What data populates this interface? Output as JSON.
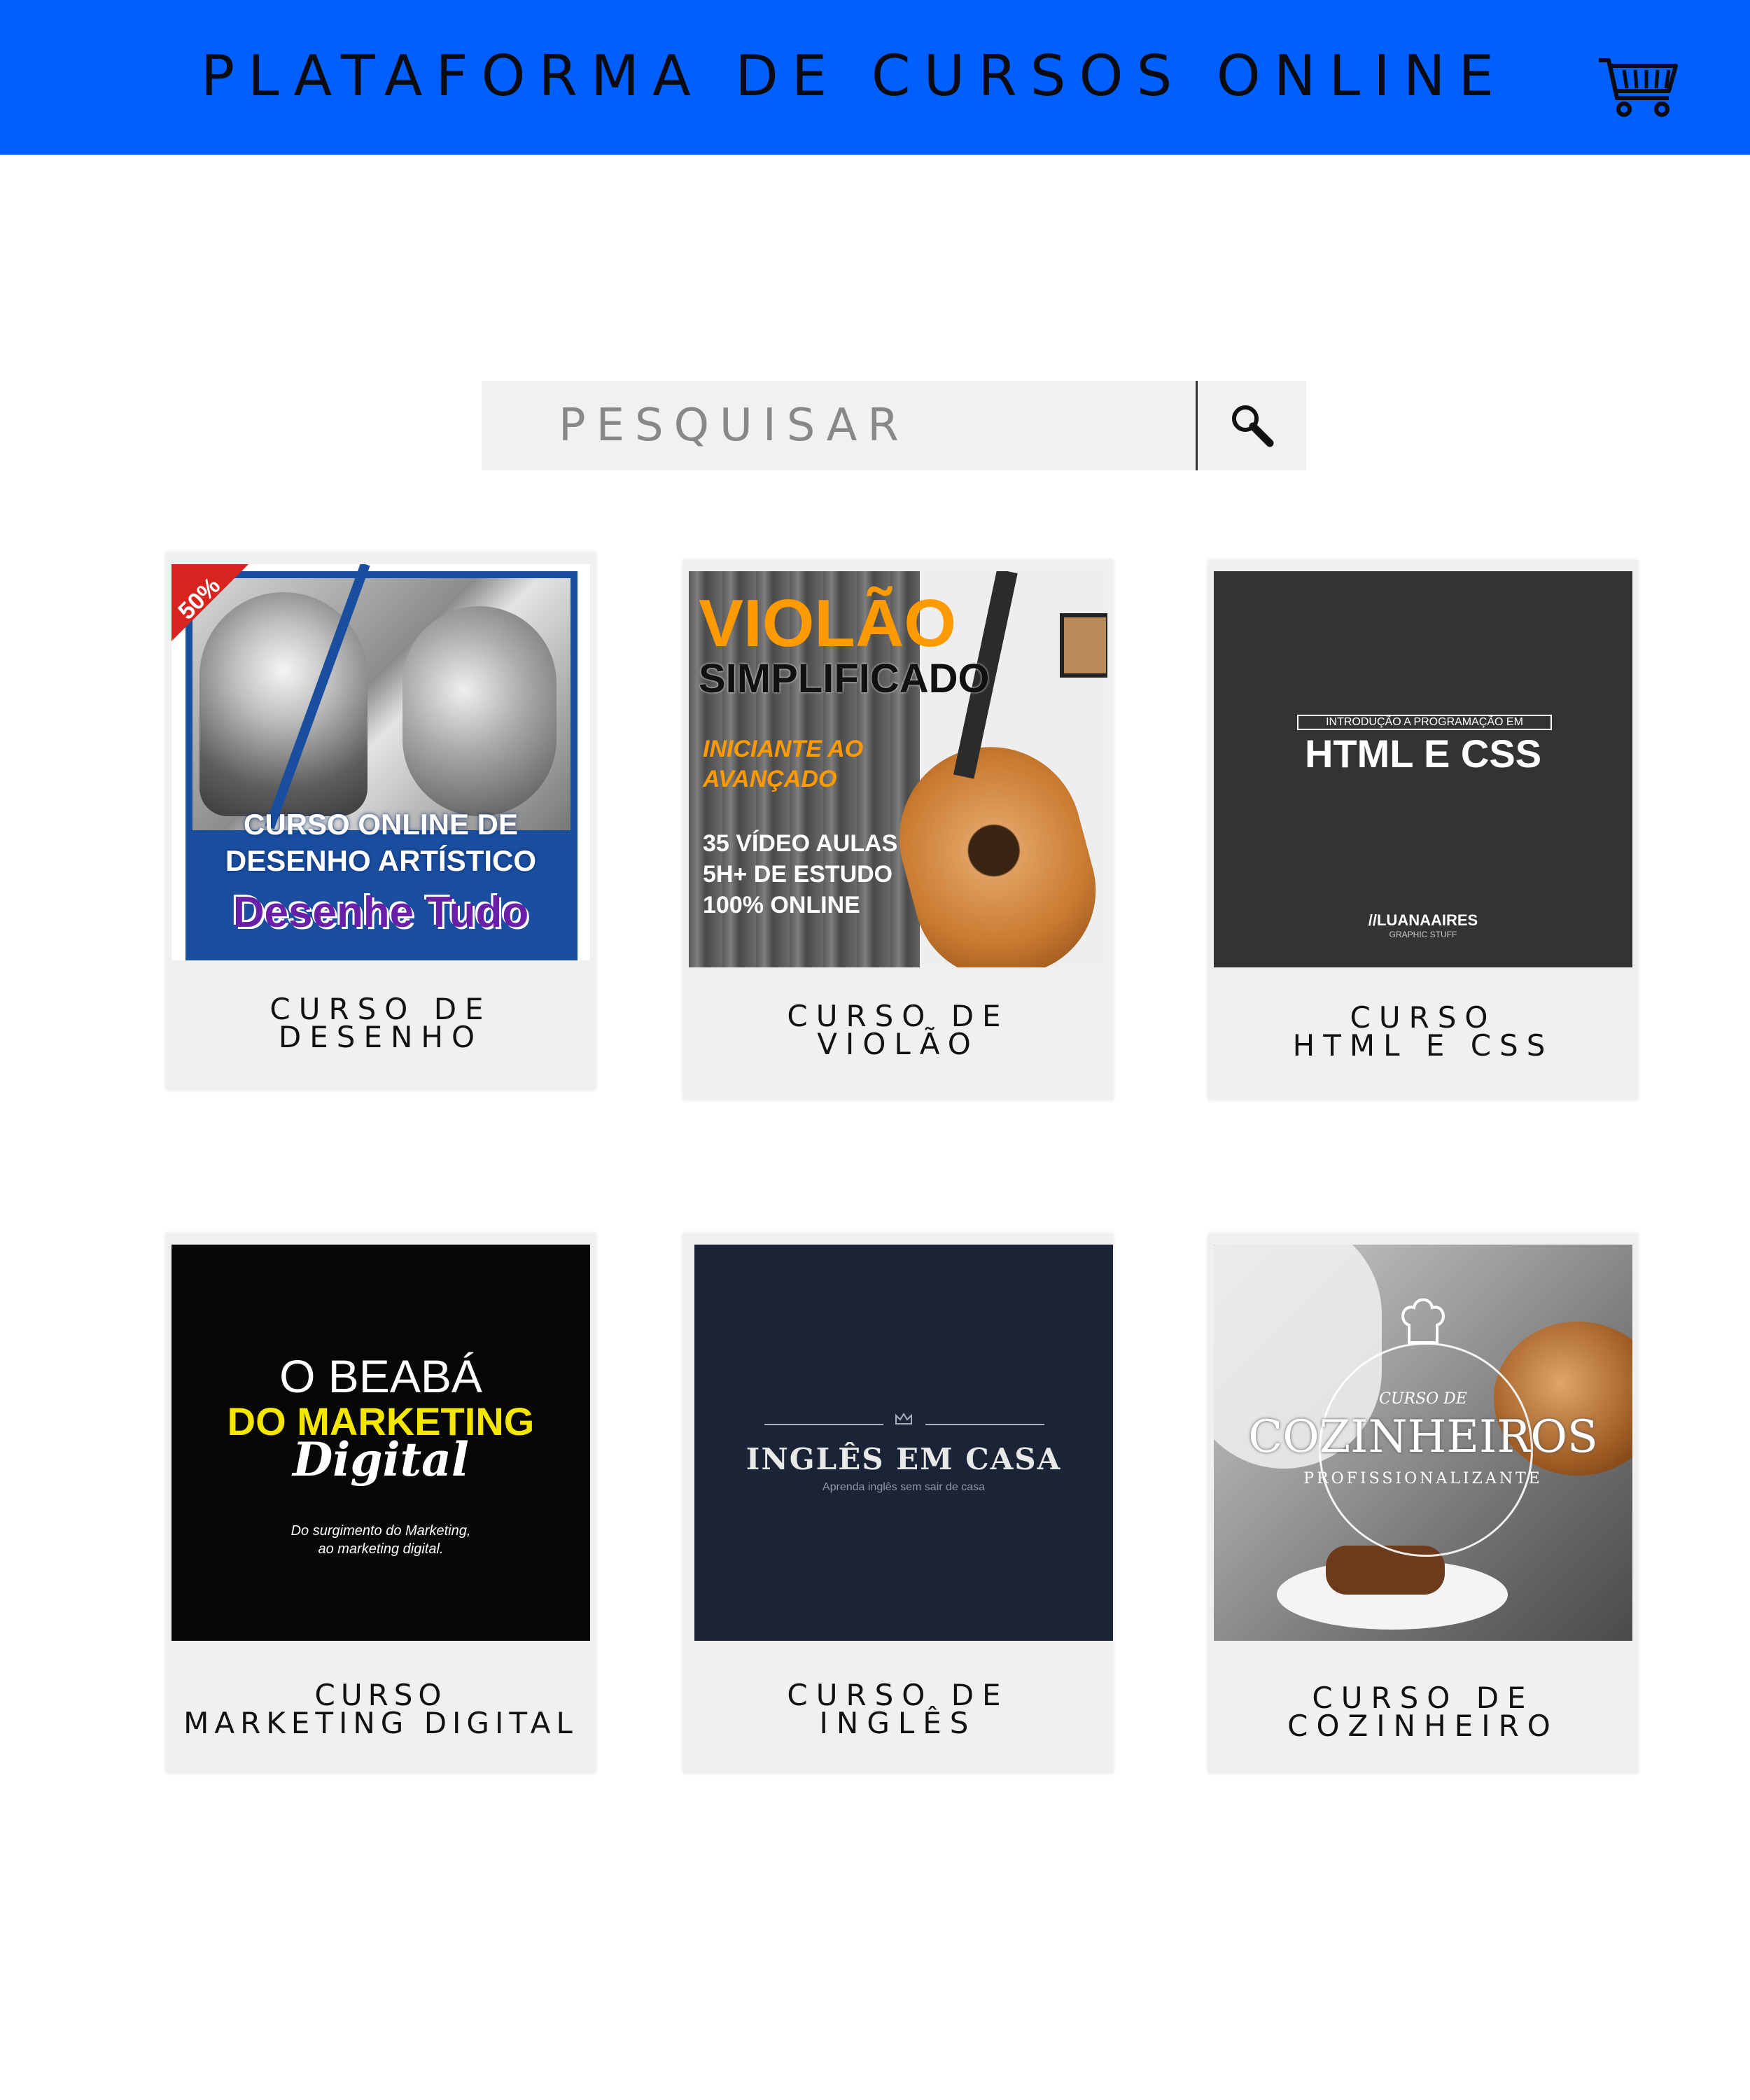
{
  "header": {
    "title": "PLATAFORMA DE CURSOS ONLINE",
    "cart_icon": "shopping-cart-icon",
    "background": "#0060ff"
  },
  "search": {
    "placeholder": "PESQUISAR",
    "icon": "magnifier-icon"
  },
  "courses": [
    {
      "line1": "CURSO DE",
      "line2": "DESENHO",
      "image": {
        "badge": "50%",
        "title_line1": "CURSO ONLINE DE",
        "title_line2": "DESENHO ARTÍSTICO",
        "subtitle": "Desenhe Tudo"
      }
    },
    {
      "line1": "CURSO DE",
      "line2": "VIOLÃO",
      "image": {
        "title": "VIOLÃO",
        "subtitle": "SIMPLIFICADO",
        "tag_line1": "INICIANTE AO",
        "tag_line2": "AVANÇADO",
        "info1": "35 VÍDEO AULAS",
        "info2": "5H+ DE ESTUDO",
        "info3": "100% ONLINE"
      }
    },
    {
      "line1": "CURSO",
      "line2": "HTML E CSS",
      "image": {
        "overline": "INTRODUÇÃO A PROGRAMAÇÃO EM",
        "title": "HTML E CSS",
        "brand": "//LUANAAIRES",
        "brand_sub": "GRAPHIC STUFF"
      }
    },
    {
      "line1": "CURSO",
      "line2": "MARKETING DIGITAL",
      "image": {
        "line1": "O BEABÁ",
        "line2": "DO MARKETING",
        "line3": "Digital",
        "desc1": "Do surgimento do Marketing,",
        "desc2": "ao marketing digital."
      }
    },
    {
      "line1": "CURSO DE",
      "line2": "INGLÊS",
      "image": {
        "title": "INGLÊS EM CASA",
        "subtitle": "Aprenda inglês sem sair de casa"
      }
    },
    {
      "line1": "CURSO DE",
      "line2": "COZINHEIRO",
      "image": {
        "overline": "CURSO DE",
        "title": "COZINHEIROS",
        "subtitle": "PROFISSIONALIZANTE"
      }
    }
  ]
}
